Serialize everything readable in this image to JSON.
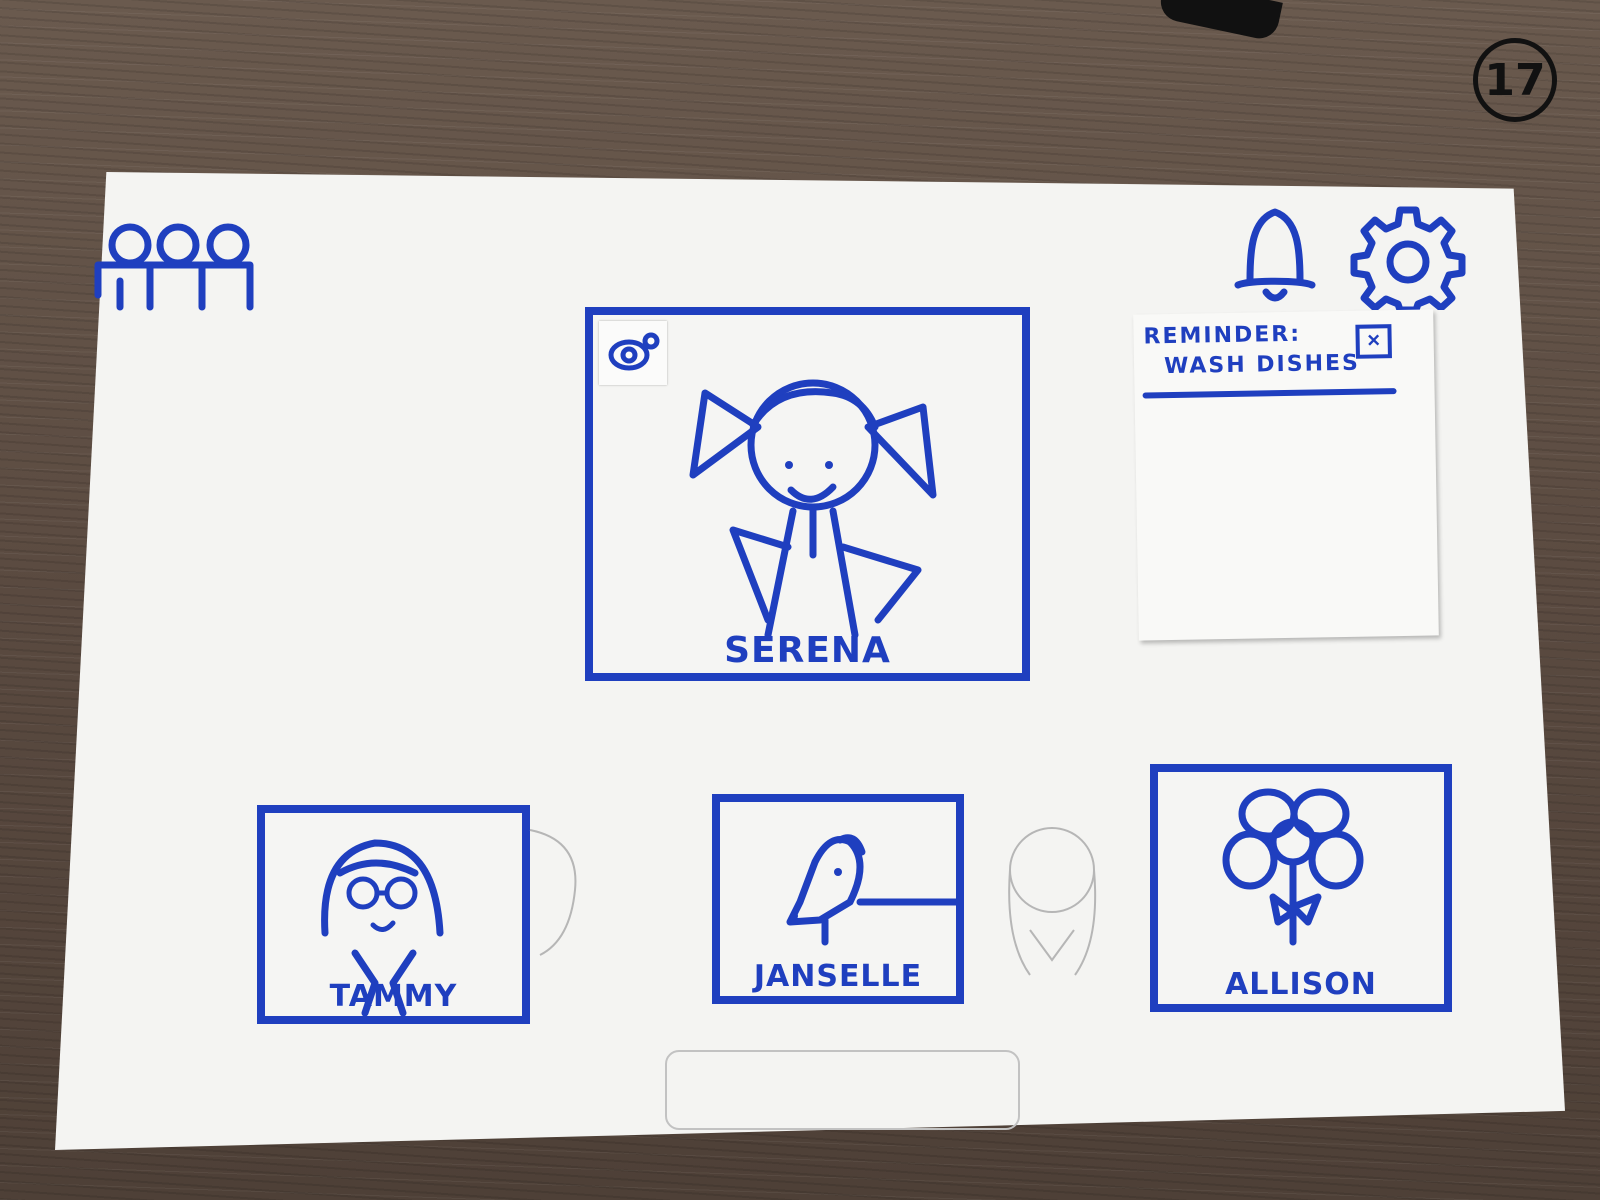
{
  "page_number": "17",
  "header": {
    "left_icon": "people-group-icon",
    "right_icons": [
      "bell-icon",
      "gear-icon"
    ]
  },
  "main_video": {
    "name": "SERENA",
    "corner_button_icon": "camera-switch-icon"
  },
  "reminder": {
    "title": "REMINDER:",
    "text": "WASH DISHES",
    "close_icon": "close-checkbox-icon",
    "close_glyph": "×"
  },
  "participants": [
    {
      "name": "TAMMY",
      "avatar": "girl-with-glasses"
    },
    {
      "name": "JANSELLE",
      "avatar": "dog"
    },
    {
      "name": "ALLISON",
      "avatar": "flower"
    }
  ],
  "colors": {
    "ink": "#1f3fbf",
    "paper": "#f4f4f2",
    "table": "#5f5045"
  }
}
